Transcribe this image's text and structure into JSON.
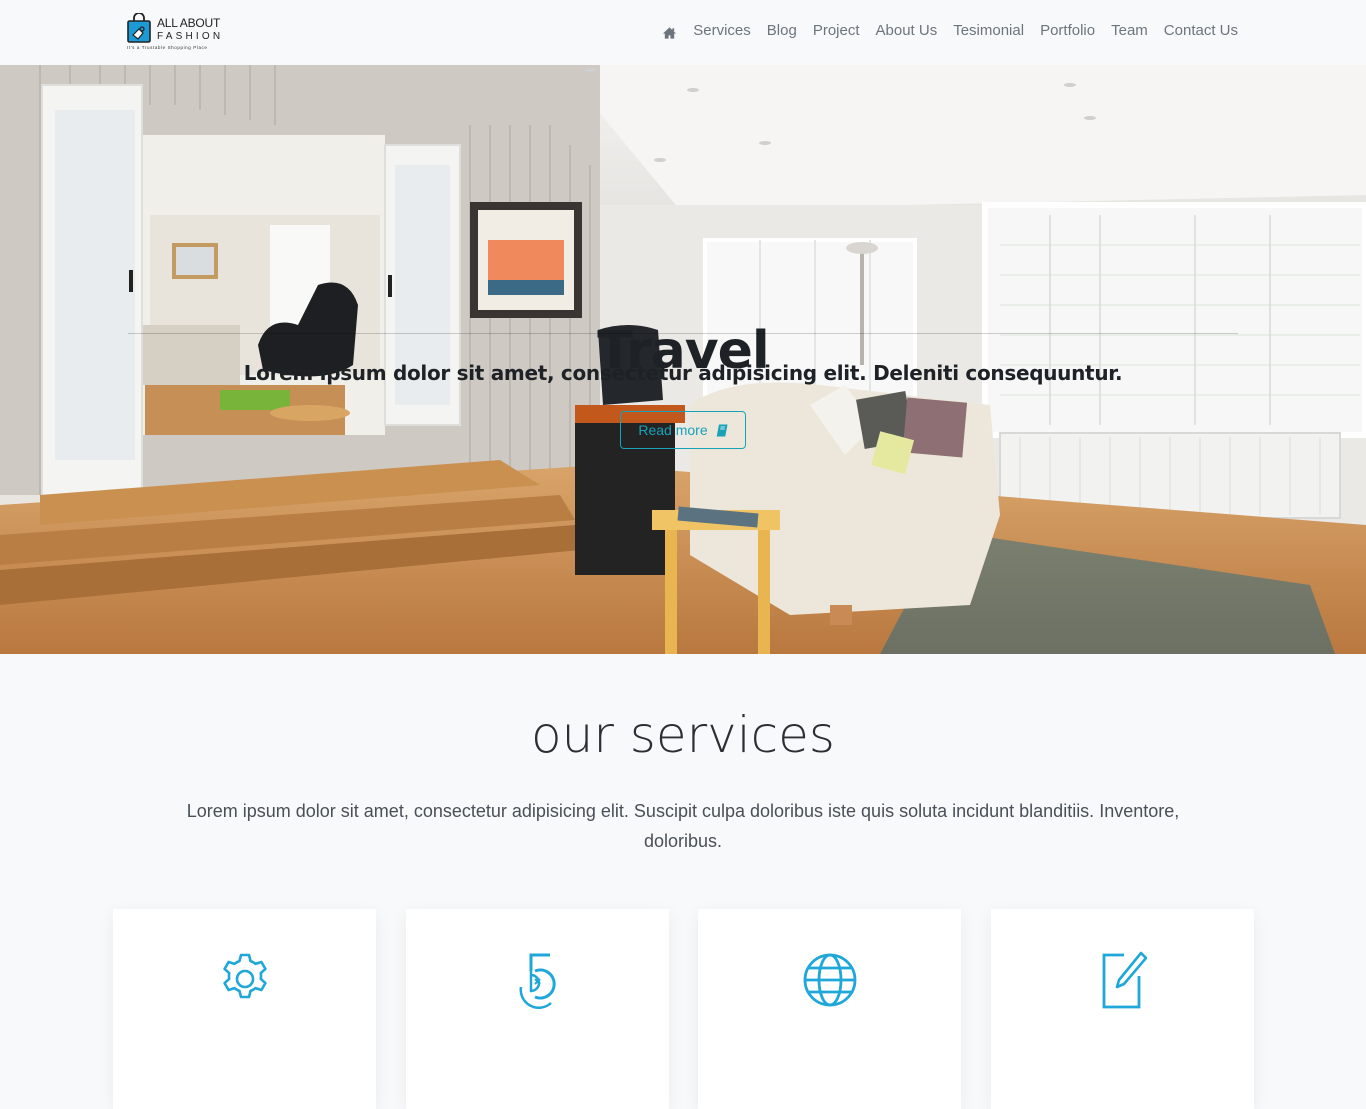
{
  "brand": {
    "line1": "ALL ABOUT",
    "line2": "FASHION",
    "tagline": "It's a Trustable Shopping Place",
    "icon": "shopping-bag-icon",
    "accent_color": "#1b9ad6"
  },
  "nav": {
    "home_icon": "home-icon",
    "items": [
      {
        "label": "Services"
      },
      {
        "label": "Blog"
      },
      {
        "label": "Project"
      },
      {
        "label": "About Us"
      },
      {
        "label": "Tesimonial"
      },
      {
        "label": "Portfolio"
      },
      {
        "label": "Team"
      },
      {
        "label": "Contact Us"
      }
    ]
  },
  "hero": {
    "title": "Travel",
    "subtitle": "Lorem ipsum dolor sit amet, consectetur adipisicing elit. Deleniti consequuntur.",
    "button": {
      "label": "Read more",
      "icon": "book-icon",
      "color": "#17a2b8"
    },
    "background": "living-room-interior-photo"
  },
  "services": {
    "title": "our services",
    "description": "Lorem ipsum dolor sit amet, consectetur adipisicing elit. Suscipit culpa doloribus iste quis soluta incidunt blanditiis. Inventore, doloribus.",
    "icon_color": "#1ea7d8",
    "cards": [
      {
        "icon": "gear-icon"
      },
      {
        "icon": "html5-badge-icon"
      },
      {
        "icon": "globe-icon"
      },
      {
        "icon": "edit-icon"
      }
    ]
  }
}
